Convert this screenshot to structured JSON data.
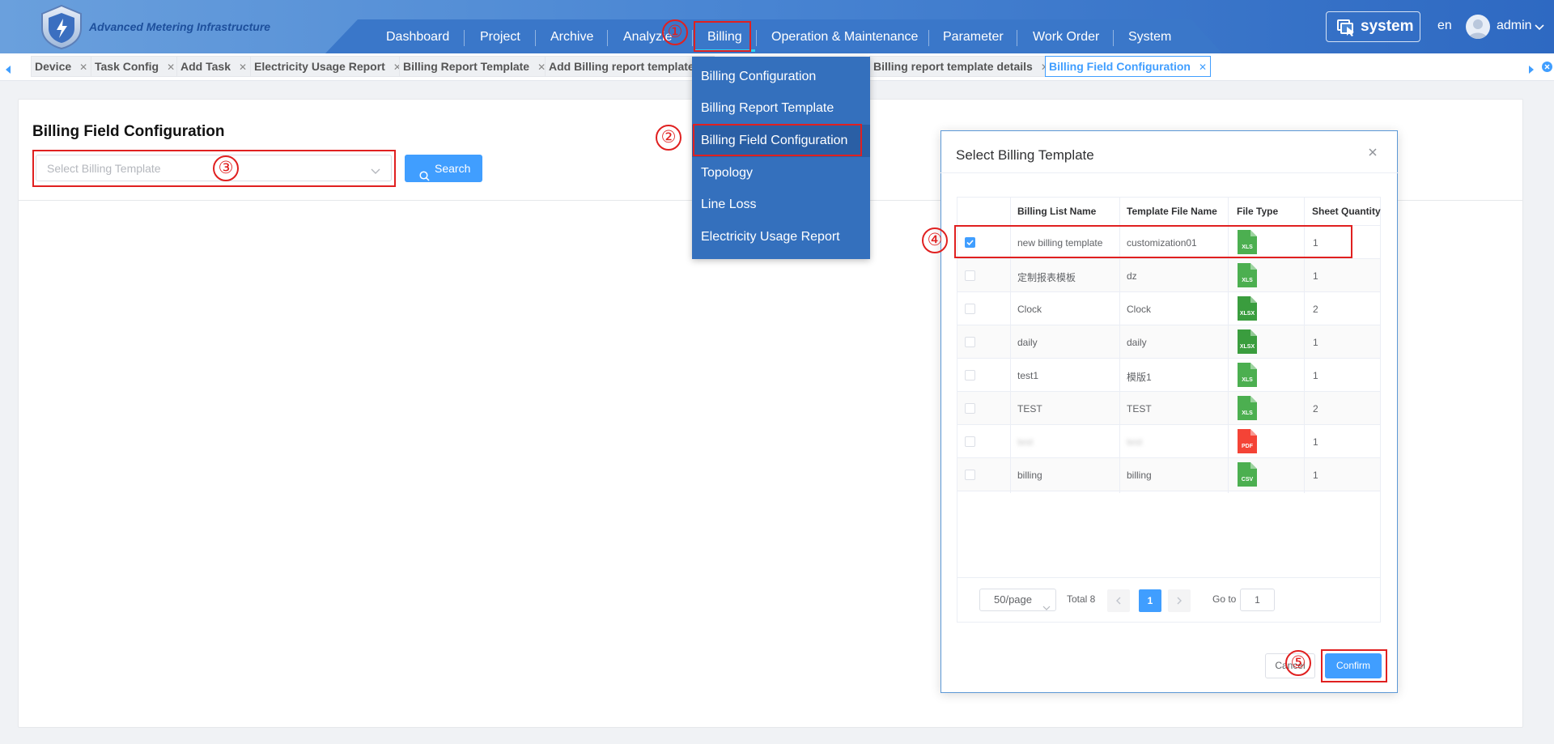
{
  "header": {
    "brand": "Advanced Metering Infrastructure",
    "nav": [
      "Dashboard",
      "Project",
      "Archive",
      "Analyzie",
      "Billing",
      "Operation & Maintenance",
      "Parameter",
      "Work Order",
      "System"
    ],
    "system_label": "system",
    "lang": "en",
    "user": "admin"
  },
  "tabs": [
    {
      "label": "Device"
    },
    {
      "label": "Task Config"
    },
    {
      "label": "Add Task"
    },
    {
      "label": "Electricity Usage Report"
    },
    {
      "label": "Billing Report Template"
    },
    {
      "label": "Add Billing report template"
    },
    {
      "label": "Billing report template details"
    },
    {
      "label": "Billing Field Configuration"
    }
  ],
  "billing_menu": [
    "Billing Configuration",
    "Billing Report Template",
    "Billing Field Configuration",
    "Topology",
    "Line Loss",
    "Electricity Usage Report"
  ],
  "page": {
    "title": "Billing Field Configuration",
    "select_placeholder": "Select Billing Template",
    "search_label": "Search"
  },
  "modal": {
    "title": "Select Billing Template",
    "columns": [
      "Billing List Name",
      "Template File Name",
      "File Type",
      "Sheet Quantity"
    ],
    "rows": [
      {
        "name": "new billing template",
        "file": "customization01",
        "type": "XLS",
        "sheets": "1",
        "checked": true
      },
      {
        "name": "定制报表模板",
        "file": "dz",
        "type": "XLS",
        "sheets": "1",
        "checked": false
      },
      {
        "name": "Clock",
        "file": "Clock",
        "type": "XLSX",
        "sheets": "2",
        "checked": false
      },
      {
        "name": "daily",
        "file": "daily",
        "type": "XLSX",
        "sheets": "1",
        "checked": false
      },
      {
        "name": "test1",
        "file": "模版1",
        "type": "XLS",
        "sheets": "1",
        "checked": false
      },
      {
        "name": "TEST",
        "file": "TEST",
        "type": "XLS",
        "sheets": "2",
        "checked": false
      },
      {
        "name": "test",
        "file": "test",
        "type": "PDF",
        "sheets": "1",
        "checked": false
      },
      {
        "name": "billing",
        "file": "billing",
        "type": "CSV",
        "sheets": "1",
        "checked": false
      }
    ],
    "pager": {
      "size": "50/page",
      "total": "Total 8",
      "current": "1",
      "goto_label": "Go to",
      "goto_value": "1"
    },
    "cancel": "Cancel",
    "confirm": "Confirm"
  },
  "annotations": [
    "①",
    "②",
    "③",
    "④",
    "⑤"
  ],
  "colors": {
    "primary": "#409eff",
    "header": "#3a77c9",
    "annotation": "#e02020",
    "xls": "#4caf50",
    "pdf": "#f44336"
  }
}
